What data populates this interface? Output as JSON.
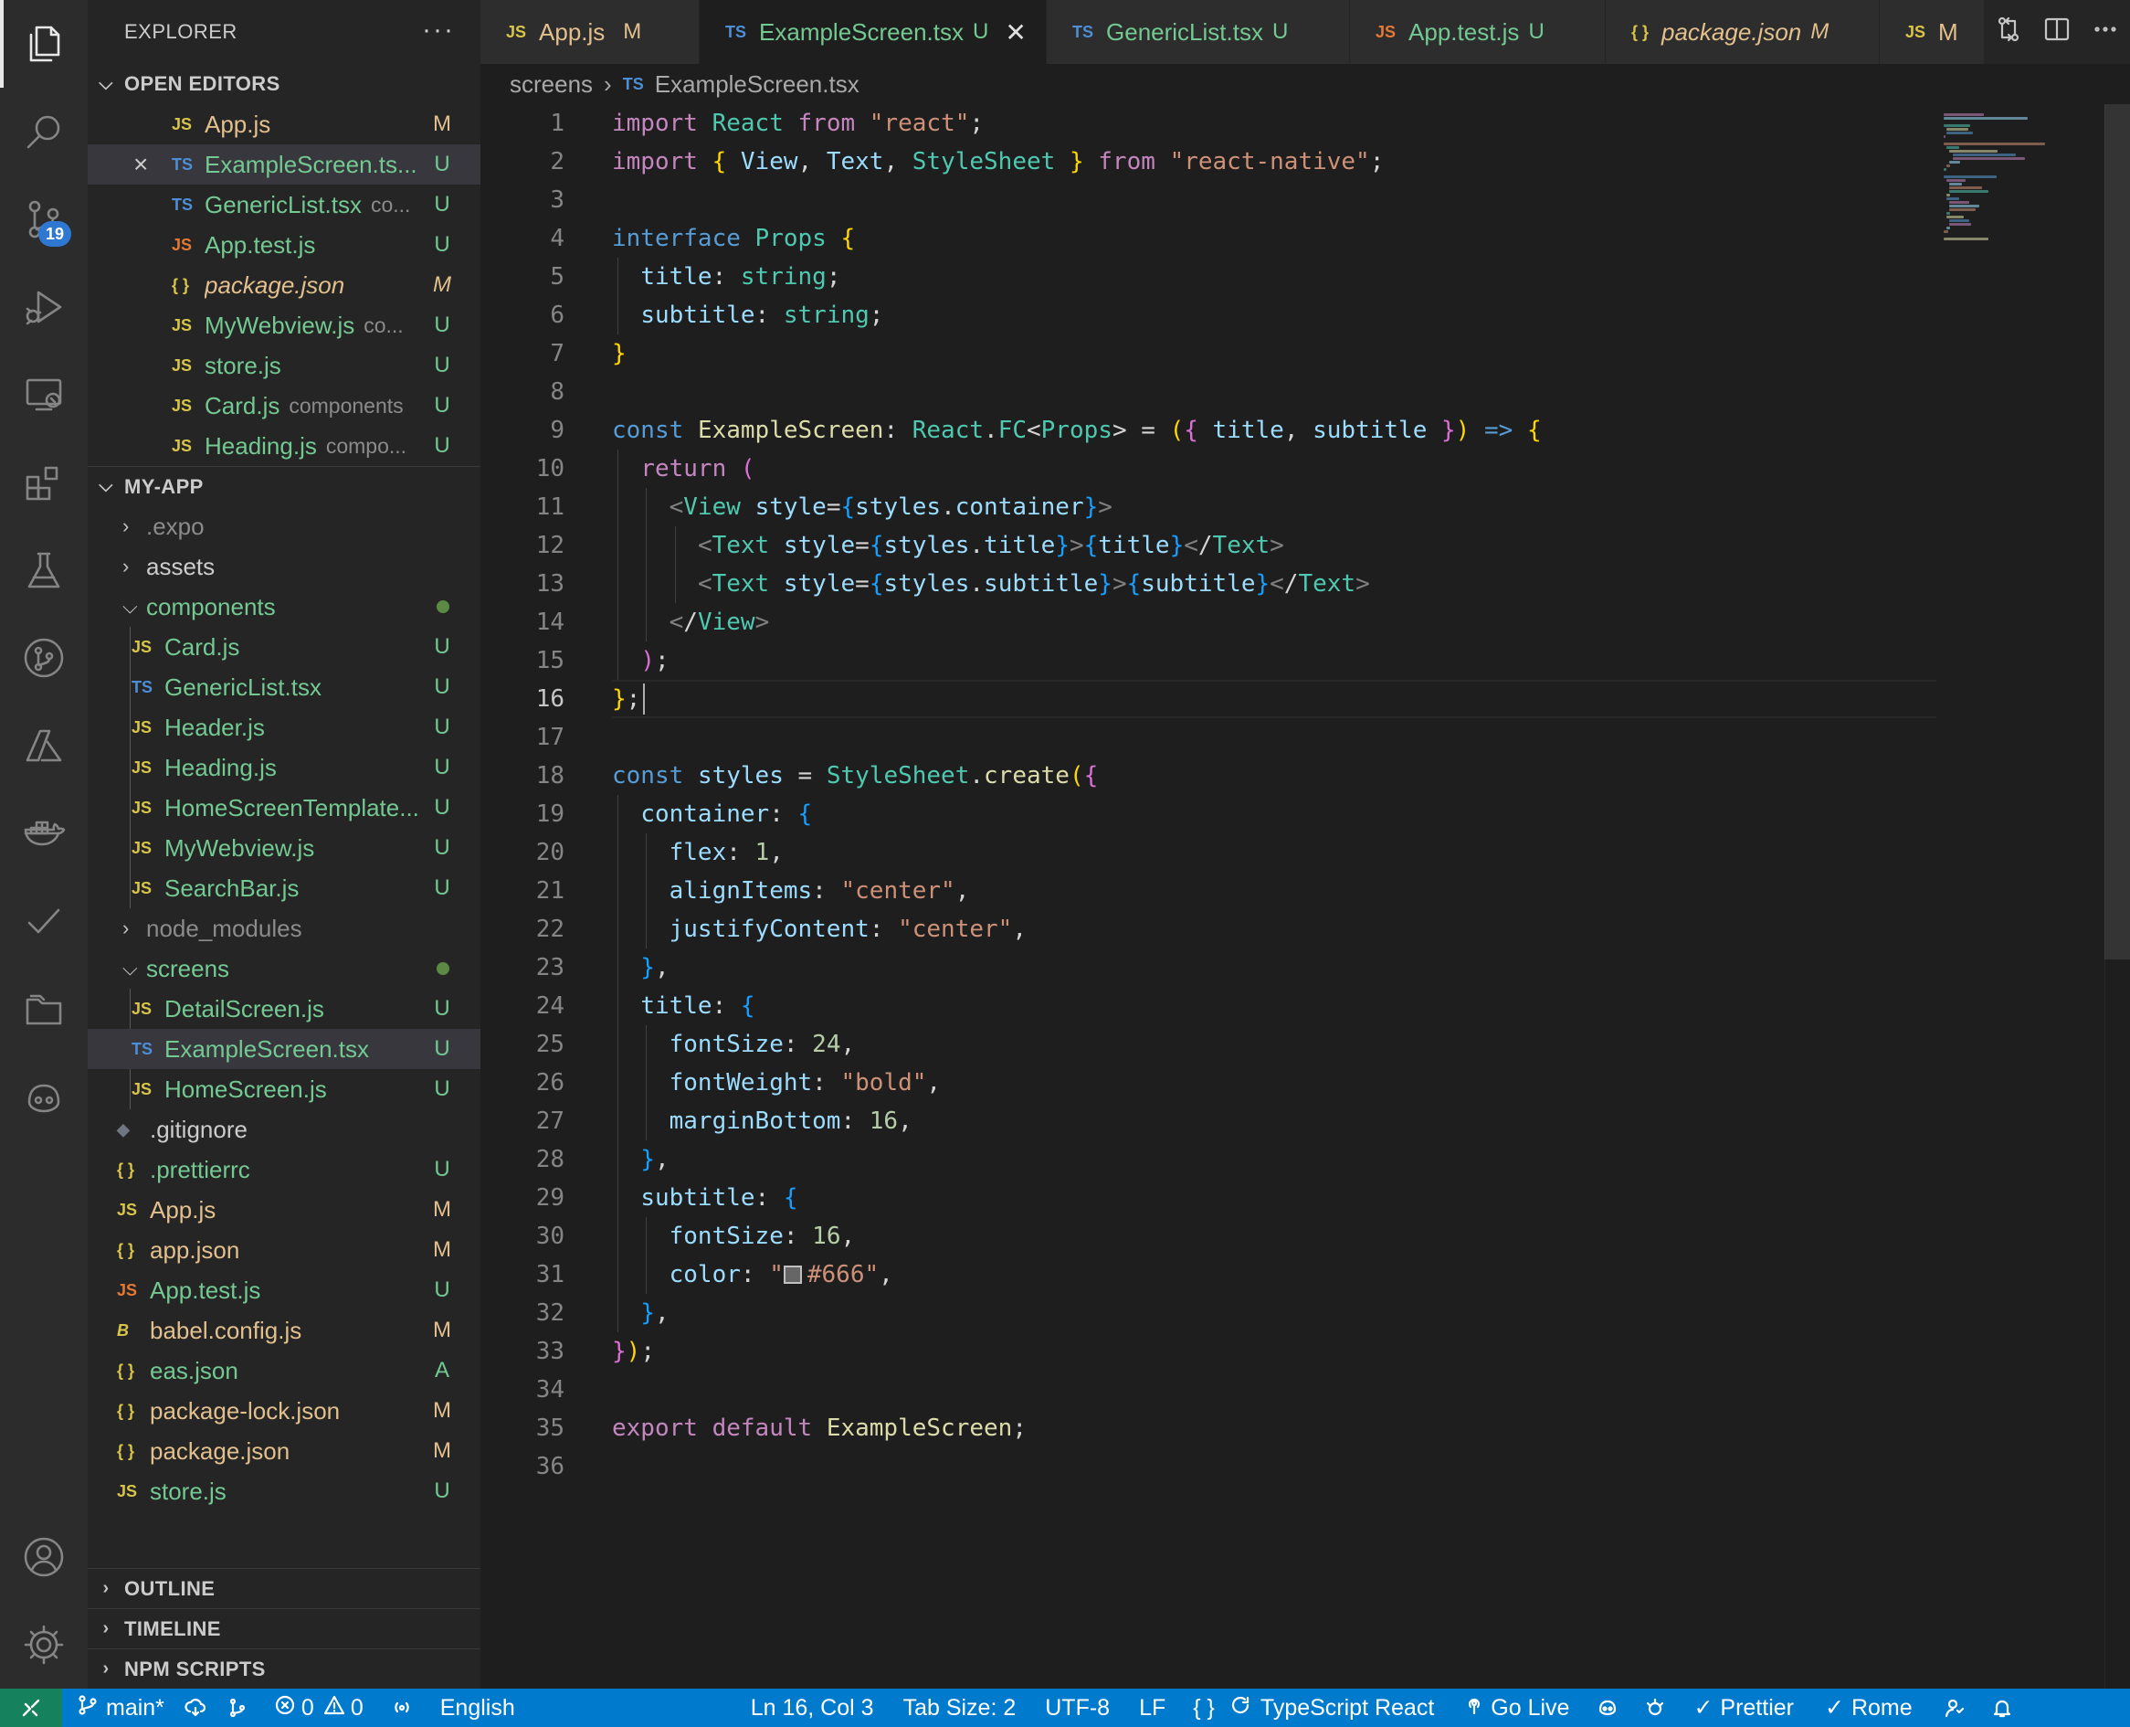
{
  "activity_bar": {
    "items": [
      "explorer-icon",
      "search-icon",
      "source-control-icon",
      "run-debug-icon",
      "remote-explorer-icon",
      "extensions-icon",
      "testing-icon",
      "git-graph-icon",
      "azure-icon",
      "docker-icon",
      "todo-check-icon",
      "project-manager-icon",
      "copilot-icon"
    ],
    "source_control_badge": "19",
    "bottom": [
      "account-icon",
      "settings-gear-icon"
    ]
  },
  "sidebar": {
    "title": "EXPLORER",
    "more_label": "···",
    "open_editors": {
      "label": "OPEN EDITORS",
      "items": [
        {
          "icon": "JS",
          "name": "App.js",
          "desc": "",
          "status": "M"
        },
        {
          "icon": "TS",
          "name": "ExampleScreen.ts...",
          "desc": "",
          "status": "U"
        },
        {
          "icon": "TS",
          "name": "GenericList.tsx",
          "desc": "co...",
          "status": "U"
        },
        {
          "icon": "JS",
          "name": "App.test.js",
          "desc": "",
          "status": "U"
        },
        {
          "icon": "{ }",
          "name": "package.json",
          "desc": "",
          "status": "M"
        },
        {
          "icon": "JS",
          "name": "MyWebview.js",
          "desc": "co...",
          "status": "U"
        },
        {
          "icon": "JS",
          "name": "store.js",
          "desc": "",
          "status": "U"
        },
        {
          "icon": "JS",
          "name": "Card.js",
          "desc": "components",
          "status": "U"
        },
        {
          "icon": "JS",
          "name": "Heading.js",
          "desc": "compo...",
          "status": "U"
        }
      ]
    },
    "project": {
      "label": "MY-APP",
      "tree": [
        {
          "type": "folder",
          "name": ".expo",
          "open": false
        },
        {
          "type": "folder",
          "name": "assets",
          "open": false
        },
        {
          "type": "folder",
          "name": "components",
          "open": true
        },
        {
          "icon": "JS",
          "name": "Card.js",
          "status": "U"
        },
        {
          "icon": "TS",
          "name": "GenericList.tsx",
          "status": "U"
        },
        {
          "icon": "JS",
          "name": "Header.js",
          "status": "U"
        },
        {
          "icon": "JS",
          "name": "Heading.js",
          "status": "U"
        },
        {
          "icon": "JS",
          "name": "HomeScreenTemplate...",
          "status": "U"
        },
        {
          "icon": "JS",
          "name": "MyWebview.js",
          "status": "U"
        },
        {
          "icon": "JS",
          "name": "SearchBar.js",
          "status": "U"
        },
        {
          "type": "folder",
          "name": "node_modules",
          "open": false
        },
        {
          "type": "folder",
          "name": "screens",
          "open": true
        },
        {
          "icon": "JS",
          "name": "DetailScreen.js",
          "status": "U"
        },
        {
          "icon": "TS",
          "name": "ExampleScreen.tsx",
          "status": "U"
        },
        {
          "icon": "JS",
          "name": "HomeScreen.js",
          "status": "U"
        },
        {
          "icon": "◆",
          "name": ".gitignore",
          "status": ""
        },
        {
          "icon": "{ }",
          "name": ".prettierrc",
          "status": "U"
        },
        {
          "icon": "JS",
          "name": "App.js",
          "status": "M"
        },
        {
          "icon": "{ }",
          "name": "app.json",
          "status": "M"
        },
        {
          "icon": "JS",
          "name": "App.test.js",
          "status": "U"
        },
        {
          "icon": "B",
          "name": "babel.config.js",
          "status": "M"
        },
        {
          "icon": "{ }",
          "name": "eas.json",
          "status": "A"
        },
        {
          "icon": "{ }",
          "name": "package-lock.json",
          "status": "M"
        },
        {
          "icon": "{ }",
          "name": "package.json",
          "status": "M"
        },
        {
          "icon": "JS",
          "name": "store.js",
          "status": "U"
        }
      ]
    },
    "bottom_sections": [
      "OUTLINE",
      "TIMELINE",
      "NPM SCRIPTS"
    ]
  },
  "tabs": [
    {
      "icon": "JS",
      "name": "App.js",
      "status": "M"
    },
    {
      "icon": "TS",
      "name": "ExampleScreen.tsx",
      "status": "U"
    },
    {
      "icon": "TS",
      "name": "GenericList.tsx",
      "status": "U"
    },
    {
      "icon": "JS",
      "name": "App.test.js",
      "status": "U"
    },
    {
      "icon": "{ }",
      "name": "package.json",
      "status": "M"
    },
    {
      "icon": "JS",
      "name": "M",
      "status": ""
    }
  ],
  "breadcrumb": {
    "folder": "screens",
    "file_icon": "TS",
    "file": "ExampleScreen.tsx"
  },
  "editor": {
    "current_line": 16,
    "lines": [
      "import React from \"react\";",
      "import { View, Text, StyleSheet } from \"react-native\";",
      "",
      "interface Props {",
      "  title: string;",
      "  subtitle: string;",
      "}",
      "",
      "const ExampleScreen: React.FC<Props> = ({ title, subtitle }) => {",
      "  return (",
      "    <View style={styles.container}>",
      "      <Text style={styles.title}>{title}</Text>",
      "      <Text style={styles.subtitle}>{subtitle}</Text>",
      "    </View>",
      "  );",
      "};",
      "",
      "const styles = StyleSheet.create({",
      "  container: {",
      "    flex: 1,",
      "    alignItems: \"center\",",
      "    justifyContent: \"center\",",
      "  },",
      "  title: {",
      "    fontSize: 24,",
      "    fontWeight: \"bold\",",
      "    marginBottom: 16,",
      "  },",
      "  subtitle: {",
      "    fontSize: 16,",
      "    color: \"#666\",",
      "  },",
      "});",
      "",
      "export default ExampleScreen;",
      ""
    ]
  },
  "status_bar": {
    "branch": "main*",
    "errors": "0",
    "warnings": "0",
    "language_hint": "English",
    "cursor": "Ln 16, Col 3",
    "tab_size": "Tab Size: 2",
    "encoding": "UTF-8",
    "eol": "LF",
    "language": "TypeScript React",
    "go_live": "Go Live",
    "prettier": "Prettier",
    "rome": "Rome"
  },
  "colors": {
    "status_bar": "#007acc",
    "remote": "#16825d",
    "untracked": "#73c991",
    "modified": "#e2c08d",
    "swatch": "#666666"
  }
}
